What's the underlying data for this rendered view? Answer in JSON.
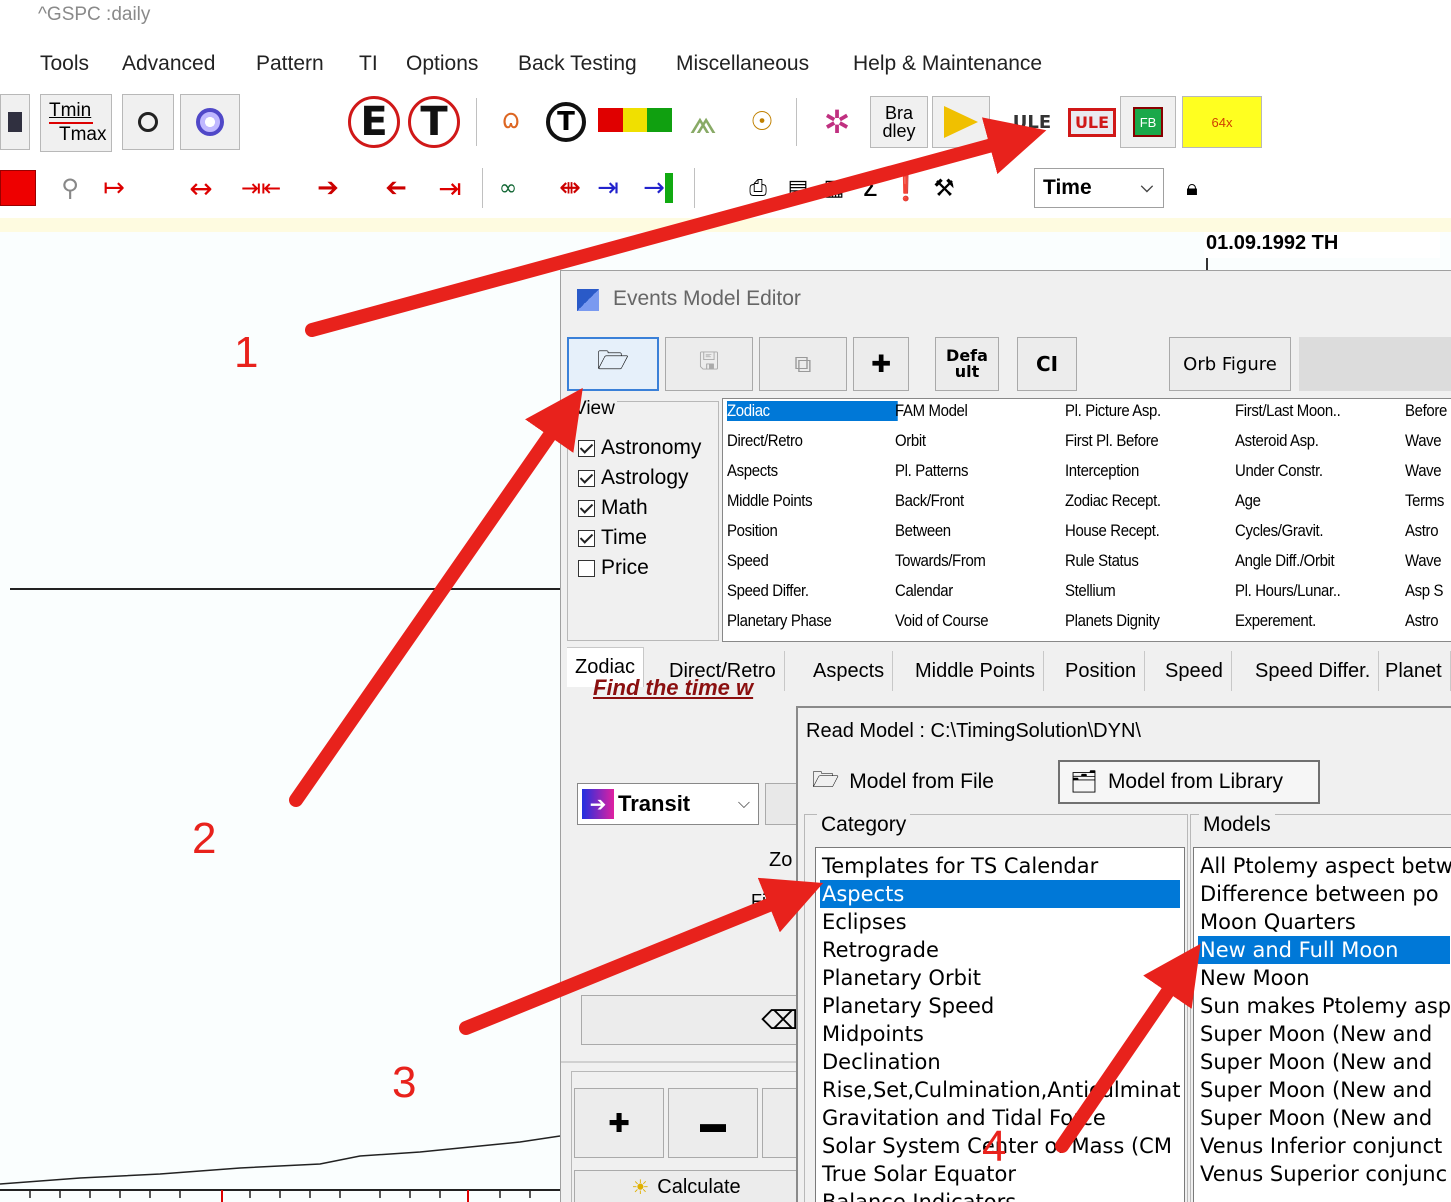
{
  "window": {
    "title": "^GSPC :daily"
  },
  "menu": [
    "Tools",
    "Advanced",
    "Pattern",
    "TI",
    "Options",
    "Back Testing",
    "Miscellaneous",
    "Help & Maintenance"
  ],
  "toolbar": {
    "tmin": "Tmin",
    "tmax": "Tmax",
    "e_letter": "E",
    "t_letter": "T",
    "bra_top": "Bra",
    "bra_bottom": "dley",
    "ule1": "ULE",
    "ule2": "ULE",
    "fb": "FB",
    "x64": "64x",
    "sigma": "Σ",
    "time_select": "Time",
    "date_label": "01.09.1992 TH"
  },
  "annotations": {
    "n1": "1",
    "n2": "2",
    "n3": "3",
    "n4": "4"
  },
  "events_editor": {
    "title": "Events Model Editor",
    "buttons": {
      "default_top": "Defa",
      "default_bottom": "ult",
      "ci": "CI",
      "orb": "Orb Figure"
    },
    "view_label": "View",
    "view_checks": [
      {
        "label": "Astronomy",
        "checked": true
      },
      {
        "label": "Astrology",
        "checked": true
      },
      {
        "label": "Math",
        "checked": true
      },
      {
        "label": "Time",
        "checked": true
      },
      {
        "label": "Price",
        "checked": false
      }
    ],
    "grid_columns": [
      [
        "Zodiac",
        "Direct/Retro",
        "Aspects",
        "Middle Points",
        "Position",
        "Speed",
        "Speed Differ.",
        "Planetary Phase"
      ],
      [
        "FAM Model",
        "Orbit",
        "Pl. Patterns",
        "Back/Front",
        "Between",
        "Towards/From",
        "Calendar",
        "Void of Course"
      ],
      [
        "Pl. Picture Asp.",
        "First Pl. Before",
        "Interception",
        "Zodiac Recept.",
        "House Recept.",
        "Rule Status",
        "Stellium",
        "Planets Dignity"
      ],
      [
        "First/Last Moon..",
        "Asteroid Asp.",
        "Under Constr.",
        "Age",
        "Cycles/Gravit.",
        "Angle Diff./Orbit",
        "Pl. Hours/Lunar..",
        "Experement."
      ],
      [
        "Before",
        "Wave",
        "Wave",
        "Terms",
        "Astro",
        "Wave",
        "Asp S",
        "Astro"
      ]
    ],
    "tabs": [
      "Zodiac",
      "Direct/Retro",
      "Aspects",
      "Middle Points",
      "Position",
      "Speed",
      "Speed Differ.",
      "Planet"
    ],
    "find_text": "Find the time w",
    "transit_select": "Transit",
    "zo_label": "Zo",
    "fi_label": "Fi",
    "calculate": "Calculate"
  },
  "read_model": {
    "title": "Read Model : C:\\TimingSolution\\DYN\\",
    "tab_file": "Model from File",
    "tab_library": "Model from Library",
    "category_label": "Category",
    "models_label": "Models",
    "categories": [
      "Templates for TS Calendar",
      "Aspects",
      "Eclipses",
      "Retrograde",
      "Planetary Orbit",
      "Planetary Speed",
      "Midpoints",
      "Declination",
      "Rise,Set,Culmination,Anticulminat",
      "Gravitation and Tidal Force",
      "Solar System Center of Mass (CM",
      "True Solar Equator",
      "Balance Indicators"
    ],
    "models": [
      "All Ptolemy aspect betw",
      "Difference between po",
      "Moon Quarters",
      "New and Full Moon",
      "New Moon",
      "Sun makes Ptolemy asp",
      "Super Moon (New and",
      "Super Moon (New and",
      "Super Moon (New and",
      "Super Moon (New and",
      "Venus Inferior conjunct",
      "Venus Superior conjunc"
    ],
    "selected_category": "Aspects",
    "selected_model": "New and Full Moon"
  },
  "colors": {
    "selection": "#0078d7",
    "arrow": "#e8221c",
    "annotation": "#e8221c"
  }
}
